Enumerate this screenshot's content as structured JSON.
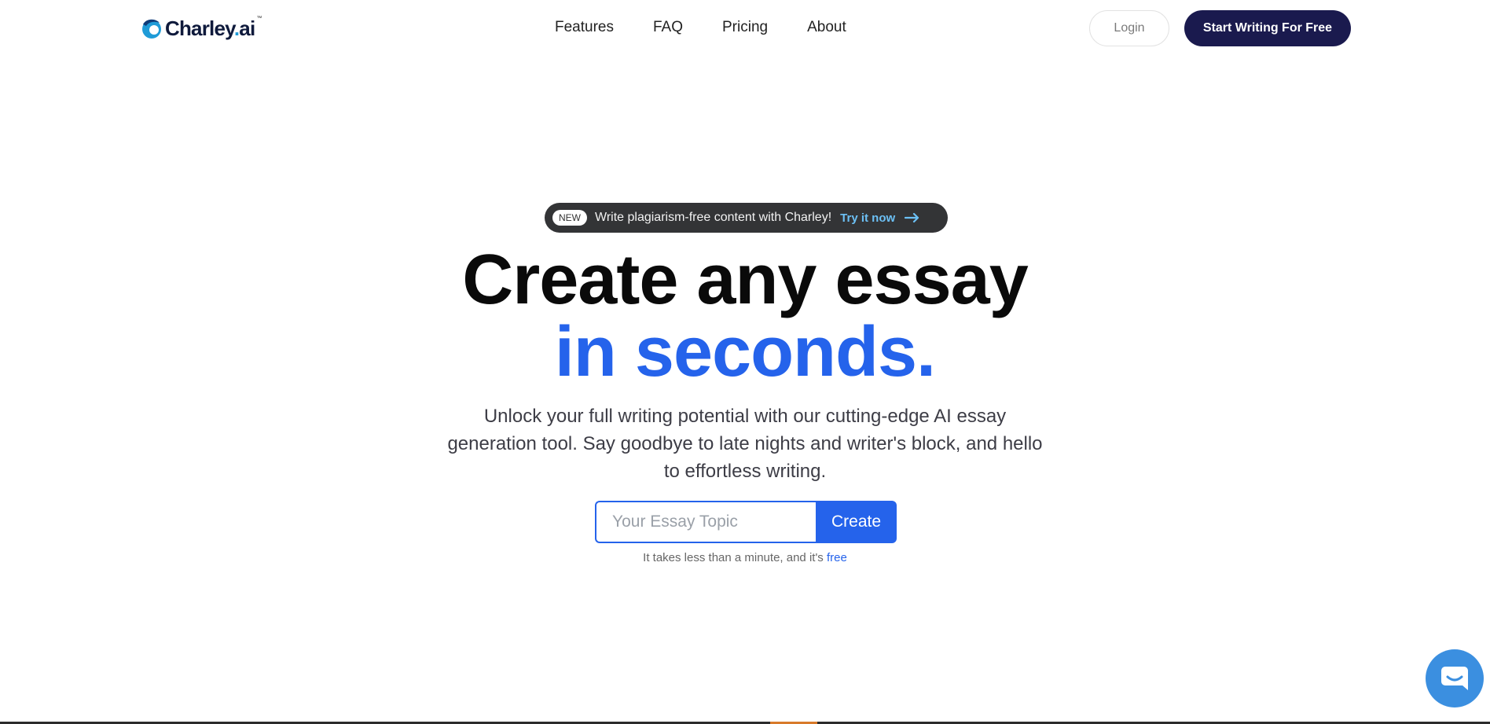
{
  "brand": {
    "name_main": "Charley",
    "name_dot": ".",
    "name_suffix": "ai",
    "tm": "™",
    "logo_icon": "charley-wave-icon"
  },
  "nav": {
    "items": [
      {
        "label": "Features"
      },
      {
        "label": "FAQ"
      },
      {
        "label": "Pricing"
      },
      {
        "label": "About"
      }
    ]
  },
  "header_actions": {
    "login_label": "Login",
    "cta_label": "Start Writing For Free"
  },
  "announcement": {
    "badge": "NEW",
    "text": "Write plagiarism-free content with Charley!",
    "link_label": "Try it now",
    "icon": "arrow-right-icon"
  },
  "hero": {
    "headline_line1": "Create any essay",
    "headline_line2": "in seconds.",
    "subtitle": "Unlock your full writing potential with our cutting-edge AI essay generation tool. Say goodbye to late nights and writer's block, and hello to effortless writing."
  },
  "essay_form": {
    "value": "",
    "placeholder": "Your Essay Topic",
    "button_label": "Create"
  },
  "note": {
    "text": "It takes less than a minute, and it's ",
    "highlight": "free"
  },
  "chat_widget": {
    "icon": "chat-bubble-icon"
  },
  "colors": {
    "accent_blue": "#2563eb",
    "cta_navy": "#1a1a4e",
    "announce_bg": "#333436",
    "link_light_blue": "#6cc0f5",
    "chat_blue": "#3b8fe0"
  }
}
